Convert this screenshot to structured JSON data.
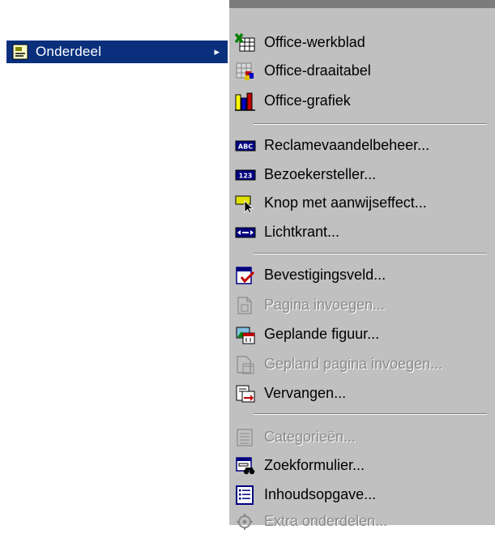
{
  "parent": {
    "label": "Onderdeel",
    "arrow": "▸"
  },
  "menu": {
    "items": [
      {
        "label": "Office-werkblad",
        "icon": "spreadsheet-icon",
        "enabled": true
      },
      {
        "label": "Office-draaitabel",
        "icon": "pivot-table-icon",
        "enabled": true
      },
      {
        "label": "Office-grafiek",
        "icon": "chart-icon",
        "enabled": true
      },
      {
        "label": "Reclamevaandelbeheer...",
        "icon": "banner-ad-icon",
        "icon_text": "ABC",
        "enabled": true
      },
      {
        "label": "Bezoekersteller...",
        "icon": "hit-counter-icon",
        "icon_text": "123",
        "enabled": true
      },
      {
        "label": "Knop met aanwijseffect...",
        "icon": "hover-button-icon",
        "enabled": true
      },
      {
        "label": "Lichtkrant...",
        "icon": "marquee-icon",
        "enabled": true
      },
      {
        "label": "Bevestigingsveld...",
        "icon": "confirmation-field-icon",
        "enabled": true
      },
      {
        "label": "Pagina invoegen...",
        "icon": "include-page-icon",
        "enabled": false
      },
      {
        "label": "Geplande figuur...",
        "icon": "scheduled-picture-icon",
        "enabled": true
      },
      {
        "label": "Gepland pagina invoegen...",
        "icon": "scheduled-include-icon",
        "enabled": false
      },
      {
        "label": "Vervangen...",
        "icon": "substitution-icon",
        "enabled": true
      },
      {
        "label": "Categorieën...",
        "icon": "categories-icon",
        "enabled": false
      },
      {
        "label": "Zoekformulier...",
        "icon": "search-form-icon",
        "enabled": true
      },
      {
        "label": "Inhoudsopgave...",
        "icon": "table-of-contents-icon",
        "enabled": true
      },
      {
        "label": "Extra onderdelen...",
        "icon": "additional-components-icon",
        "enabled": false
      }
    ]
  }
}
